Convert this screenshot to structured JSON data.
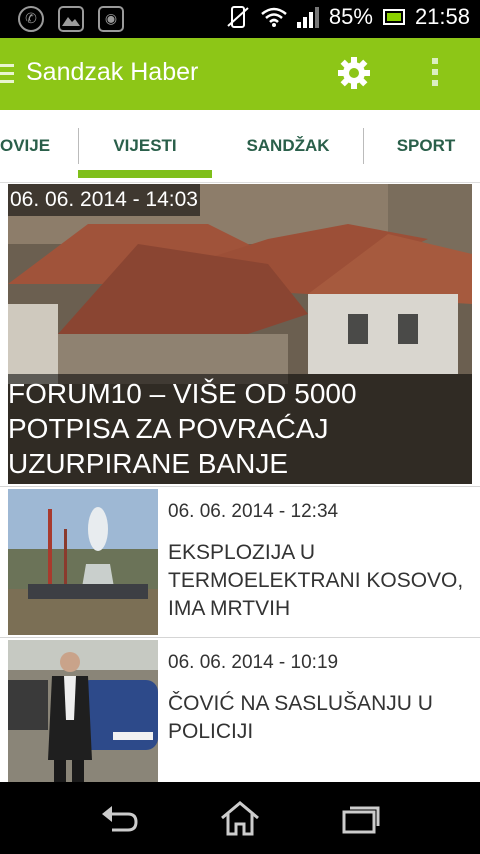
{
  "status_bar": {
    "battery_percent": "85%",
    "time": "21:58",
    "icons": [
      "whatsapp-icon",
      "gallery-icon",
      "app-icon",
      "silent-icon",
      "wifi-icon",
      "signal-icon",
      "battery-icon"
    ]
  },
  "app_bar": {
    "title": "Sandzak Haber",
    "icons": [
      "menu-icon",
      "settings-gear-icon",
      "overflow-menu-icon"
    ],
    "color": "#8dc617"
  },
  "tabs": [
    {
      "label": "OVIJE"
    },
    {
      "label": "VIJESTI",
      "selected": true
    },
    {
      "label": "SANDŽAK"
    },
    {
      "label": "SPORT"
    }
  ],
  "featured": {
    "date": "06. 06. 2014 - 14:03",
    "title_lines": [
      "FORUM10 – VIŠE OD 5000",
      "POTPISA ZA POVRAĆAJ",
      "UZURPIRANE BANJE GRAĐANIMA!"
    ]
  },
  "news": [
    {
      "date": "06. 06. 2014 - 12:34",
      "title_lines": [
        "EKSPLOZIJA U",
        "TERMOELEKTRANI KOSOVO,",
        "IMA MRTVIH"
      ]
    },
    {
      "date": "06. 06. 2014 - 10:19",
      "title_lines": [
        "ČOVIĆ NA SASLUŠANJU U",
        "POLICIJI"
      ]
    }
  ],
  "nav_bar": {
    "icons": [
      "back-icon",
      "home-icon",
      "recent-apps-icon"
    ]
  }
}
